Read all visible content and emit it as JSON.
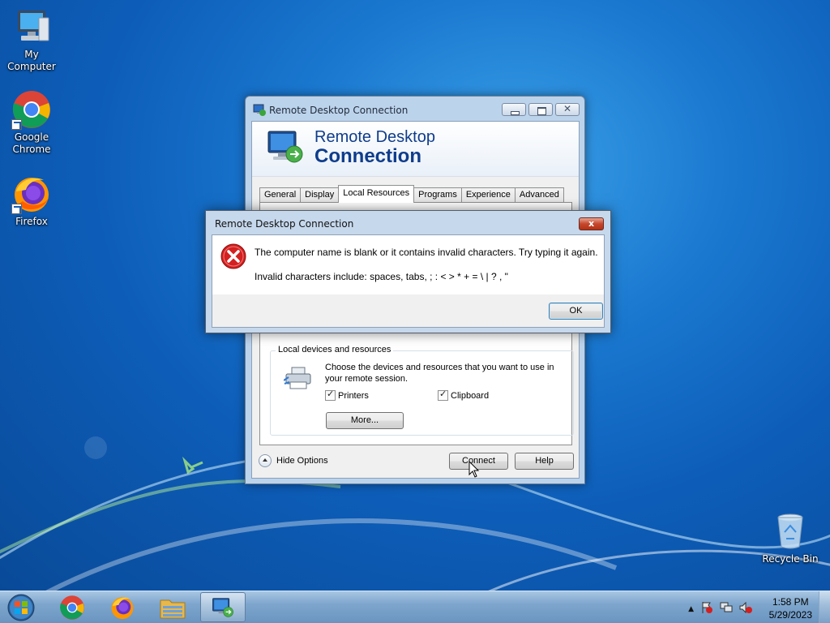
{
  "desktop": {
    "icons": [
      {
        "label": "My Computer",
        "icon": "computer-icon"
      },
      {
        "label": "Google Chrome",
        "icon": "chrome-icon"
      },
      {
        "label": "Firefox",
        "icon": "firefox-icon"
      },
      {
        "label": "Recycle Bin",
        "icon": "recycle-bin-icon"
      }
    ]
  },
  "rdc": {
    "title": "Remote Desktop Connection",
    "banner_line1": "Remote Desktop",
    "banner_line2": "Connection",
    "tabs": [
      {
        "label": "General",
        "active": false
      },
      {
        "label": "Display",
        "active": false
      },
      {
        "label": "Local Resources",
        "active": true
      },
      {
        "label": "Programs",
        "active": false
      },
      {
        "label": "Experience",
        "active": false
      },
      {
        "label": "Advanced",
        "active": false
      }
    ],
    "local_devices": {
      "legend": "Local devices and resources",
      "description": "Choose the devices and resources that you want to use in your remote session.",
      "printers_label": "Printers",
      "printers_checked": true,
      "clipboard_label": "Clipboard",
      "clipboard_checked": true,
      "more_label": "More..."
    },
    "hide_options_label": "Hide Options",
    "connect_label": "Connect",
    "help_label": "Help"
  },
  "error_dialog": {
    "title": "Remote Desktop Connection",
    "close_label": "x",
    "message": "The computer name is blank or it contains invalid characters. Try typing it again.",
    "detail": "Invalid characters include: spaces, tabs, ; : < > * + = \\ | ? , \"",
    "ok_label": "OK"
  },
  "taskbar": {
    "items": [
      "start-button",
      "chrome-icon",
      "firefox-icon",
      "explorer-icon",
      "remote-desktop-icon"
    ],
    "active_item": "remote-desktop-icon",
    "clock_time": "1:58 PM",
    "clock_date": "5/29/2023"
  },
  "colors": {
    "desktop_blue": "#0d5db8",
    "banner_text": "#0f3d8c",
    "error_red": "#d42020"
  }
}
